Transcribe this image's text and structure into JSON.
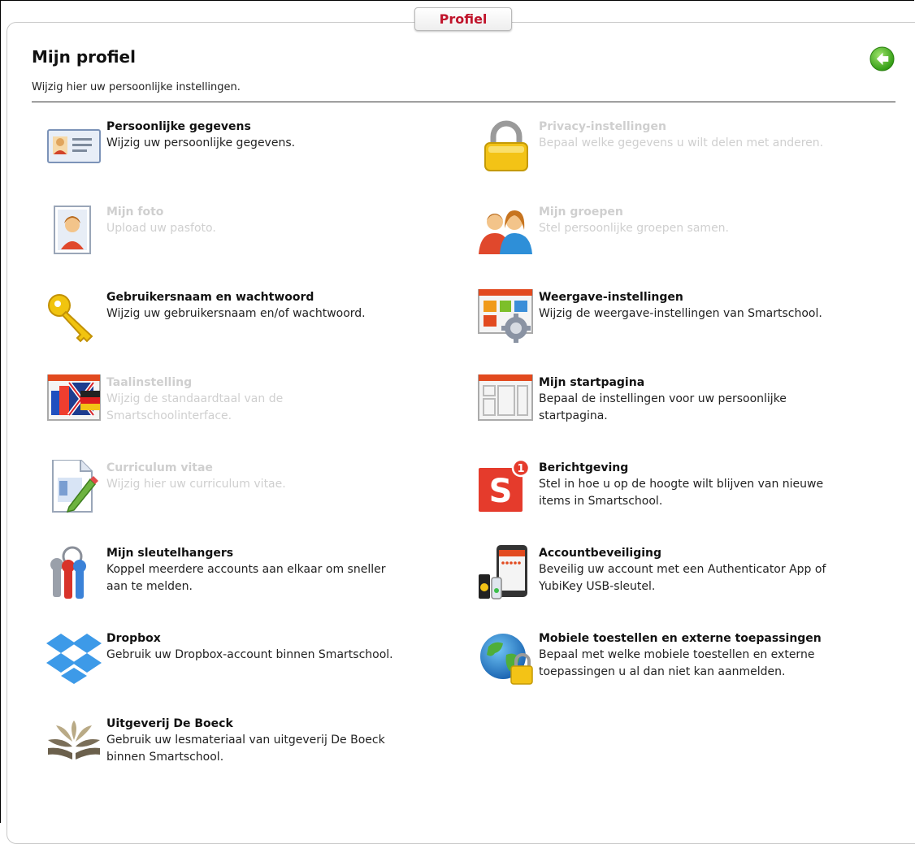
{
  "tab": {
    "label": "Profiel"
  },
  "page": {
    "title": "Mijn profiel",
    "subtitle": "Wijzig hier uw persoonlijke instellingen."
  },
  "back_button": {
    "icon": "back-arrow-icon",
    "color": "#4caf1e"
  },
  "items": [
    {
      "title": "Persoonlijke gegevens",
      "desc": "Wijzig uw persoonlijke gegevens.",
      "icon": "id-card-icon",
      "enabled": true
    },
    {
      "title": "Privacy-instellingen",
      "desc": "Bepaal welke gegevens u wilt delen met anderen.",
      "icon": "padlock-icon",
      "enabled": false
    },
    {
      "title": "Mijn foto",
      "desc": "Upload uw pasfoto.",
      "icon": "photo-portrait-icon",
      "enabled": false
    },
    {
      "title": "Mijn groepen",
      "desc": "Stel persoonlijke groepen samen.",
      "icon": "group-people-icon",
      "enabled": false
    },
    {
      "title": "Gebruikersnaam en wachtwoord",
      "desc": "Wijzig uw gebruikersnaam en/of wachtwoord.",
      "icon": "key-icon",
      "enabled": true
    },
    {
      "title": "Weergave-instellingen",
      "desc": "Wijzig de weergave-instellingen van Smartschool.",
      "icon": "display-settings-gear-icon",
      "enabled": true
    },
    {
      "title": "Taalinstelling",
      "desc1": "Wijzig de standaardtaal van de",
      "desc2": "Smartschoolinterface.",
      "icon": "flags-language-icon",
      "enabled": false
    },
    {
      "title": "Mijn startpagina",
      "desc1": "Bepaal de instellingen voor uw persoonlijke",
      "desc2": "startpagina.",
      "icon": "startpage-layout-icon",
      "enabled": true
    },
    {
      "title": "Curriculum vitae",
      "desc": "Wijzig hier uw curriculum vitae.",
      "icon": "document-pencil-icon",
      "enabled": false
    },
    {
      "title": "Berichtgeving",
      "desc1": "Stel in hoe u op de hoogte wilt blijven van nieuwe",
      "desc2": "items in Smartschool.",
      "icon": "smartschool-notification-icon",
      "badge": "1",
      "enabled": true
    },
    {
      "title": "Mijn sleutelhangers",
      "desc1": "Koppel meerdere accounts aan elkaar om sneller",
      "desc2": "aan te melden.",
      "icon": "keyring-icon",
      "enabled": true
    },
    {
      "title": "Accountbeveiliging",
      "desc1": "Beveilig uw account met een Authenticator App of",
      "desc2": "YubiKey USB-sleutel.",
      "icon": "phone-usb-key-icon",
      "enabled": true
    },
    {
      "title": "Dropbox",
      "desc": "Gebruik uw Dropbox-account binnen Smartschool.",
      "icon": "dropbox-icon",
      "enabled": true
    },
    {
      "title": "Mobiele toestellen en externe toepassingen",
      "desc1": "Bepaal met welke mobiele toestellen en externe",
      "desc2": "toepassingen u al dan niet kan aanmelden.",
      "icon": "globe-lock-icon",
      "enabled": true
    },
    {
      "title": "Uitgeverij De Boeck",
      "desc1": "Gebruik uw lesmateriaal van uitgeverij De Boeck",
      "desc2": "binnen Smartschool.",
      "icon": "de-boeck-logo-icon",
      "enabled": true
    }
  ]
}
